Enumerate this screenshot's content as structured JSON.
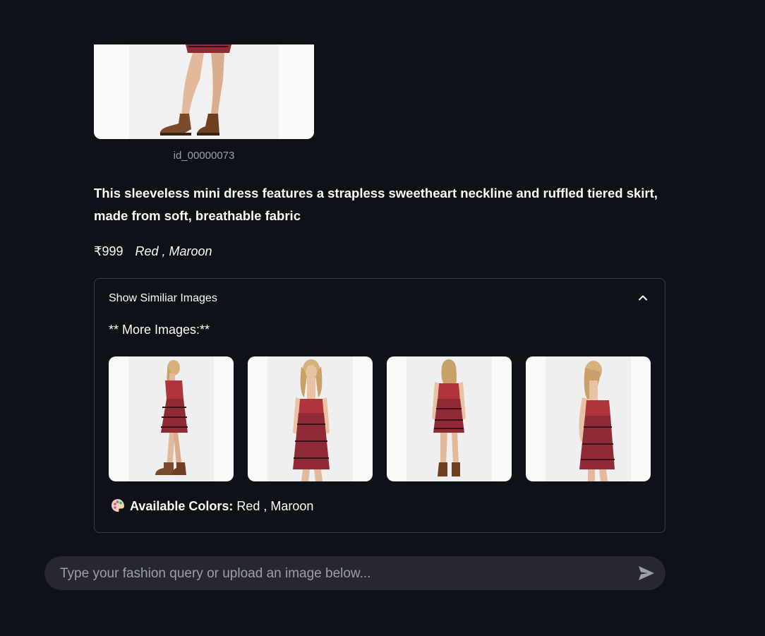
{
  "product": {
    "image_caption": "id_00000073",
    "description": "This sleeveless mini dress features a strapless sweetheart neckline and ruffled tiered skirt, made from soft, breathable fabric",
    "price": "₹999",
    "colors": "Red , Maroon"
  },
  "expander": {
    "title": "Show Similiar Images",
    "more_images_label": "** More Images:**",
    "thumbnails": [
      "similar-image-1",
      "similar-image-2",
      "similar-image-3",
      "similar-image-4"
    ],
    "available_colors_label": "Available Colors:",
    "available_colors_value": " Red , Maroon"
  },
  "chat": {
    "placeholder": "Type your fashion query or upload an image below..."
  },
  "icons": {
    "expander_toggle": "chevron-up-icon",
    "send": "send-icon",
    "palette": "palette-icon"
  },
  "colors": {
    "background": "#0e1117",
    "input_background": "#262730",
    "border": "#3a3d45",
    "dress_red": "#b0343c",
    "dress_maroon": "#6e1f2a"
  }
}
